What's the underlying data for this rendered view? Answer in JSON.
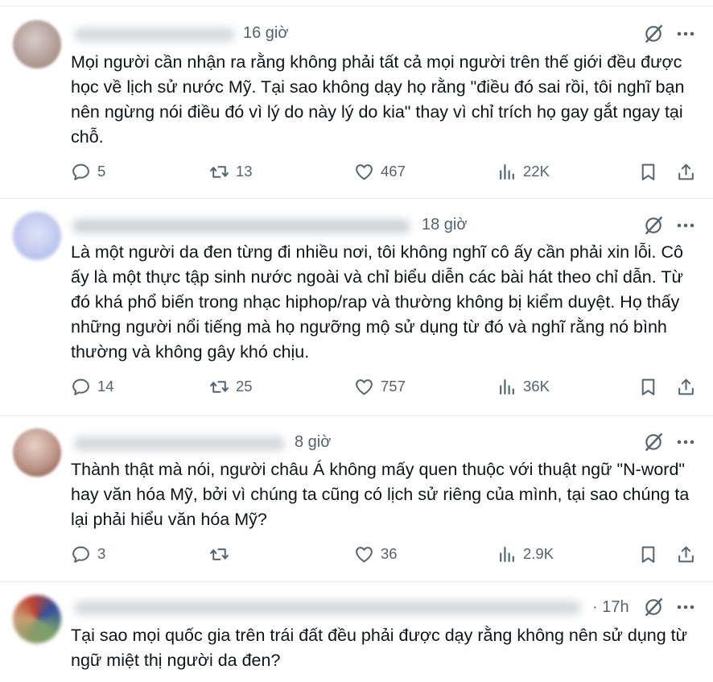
{
  "tweets": [
    {
      "time": "16 giờ",
      "text": "Mọi người cần nhận ra rằng không phải tất cả mọi người trên thế giới đều được học về lịch sử nước Mỹ. Tại sao không dạy họ rằng \"điều đó sai rồi, tôi nghĩ bạn nên ngừng nói điều đó vì lý do này lý do kia\" thay vì chỉ trích họ gay gắt ngay tại chỗ.",
      "replies": "5",
      "reposts": "13",
      "likes": "467",
      "views": "22K"
    },
    {
      "time": "18 giờ",
      "text": "Là một người da đen từng đi nhiều nơi, tôi không nghĩ cô ấy cần phải xin lỗi. Cô ấy là một thực tập sinh nước ngoài và chỉ biểu diễn các bài hát theo chỉ dẫn. Từ đó khá phổ biến trong nhạc hiphop/rap và thường không bị kiểm duyệt. Họ thấy những người nổi tiếng mà họ ngưỡng mộ sử dụng từ đó và nghĩ rằng nó bình thường và không gây khó chịu.",
      "replies": "14",
      "reposts": "25",
      "likes": "757",
      "views": "36K"
    },
    {
      "time": "8 giờ",
      "text": "Thành thật mà nói, người châu Á không mấy quen thuộc với thuật ngữ \"N-word\" hay văn hóa Mỹ, bởi vì chúng ta cũng có lịch sử riêng của mình, tại sao chúng ta lại phải hiểu văn hóa Mỹ?",
      "replies": "3",
      "reposts": "",
      "likes": "36",
      "views": "2.9K"
    },
    {
      "time": "· 17h",
      "text": "Tại sao mọi quốc gia trên trái đất đều phải được dạy rằng không nên sử dụng từ ngữ miệt thị người da đen?",
      "replies": "",
      "reposts": "",
      "likes": "",
      "views": ""
    }
  ],
  "icons": {
    "reply": "reply-icon",
    "repost": "repost-icon",
    "like": "like-icon",
    "views": "views-icon",
    "bookmark": "bookmark-icon",
    "share": "share-icon",
    "grok": "grok-icon",
    "more": "more-icon"
  },
  "colors": {
    "text": "#0f1419",
    "muted": "#536471",
    "divider": "#e7e9ea"
  }
}
